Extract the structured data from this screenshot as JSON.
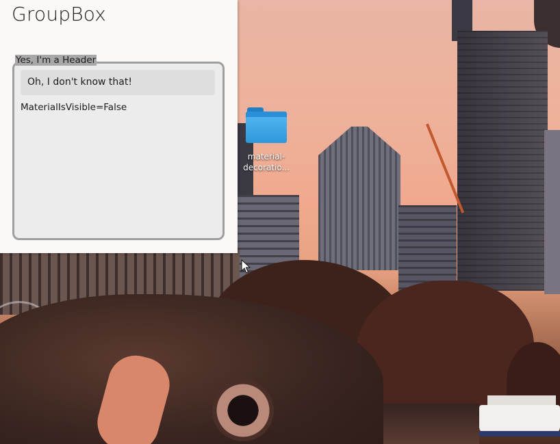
{
  "window": {
    "title": "GroupBox",
    "groupbox": {
      "header": "Yes, I'm a Header",
      "button_label": "Oh, I don't know that!",
      "content_text": "MaterialIsVisible=False"
    }
  },
  "desktop": {
    "folder_label_line1": "material-",
    "folder_label_line2": "decoratio..."
  },
  "colors": {
    "window_bg": "#fbf8f7",
    "groupbox_border": "#9e9e9e",
    "groupbox_bg": "#ececec",
    "header_bg": "#a8a8a8",
    "folder_blue": "#2a8fd6"
  },
  "icons": {
    "folder": "folder-icon",
    "cursor": "mouse-cursor-icon"
  }
}
